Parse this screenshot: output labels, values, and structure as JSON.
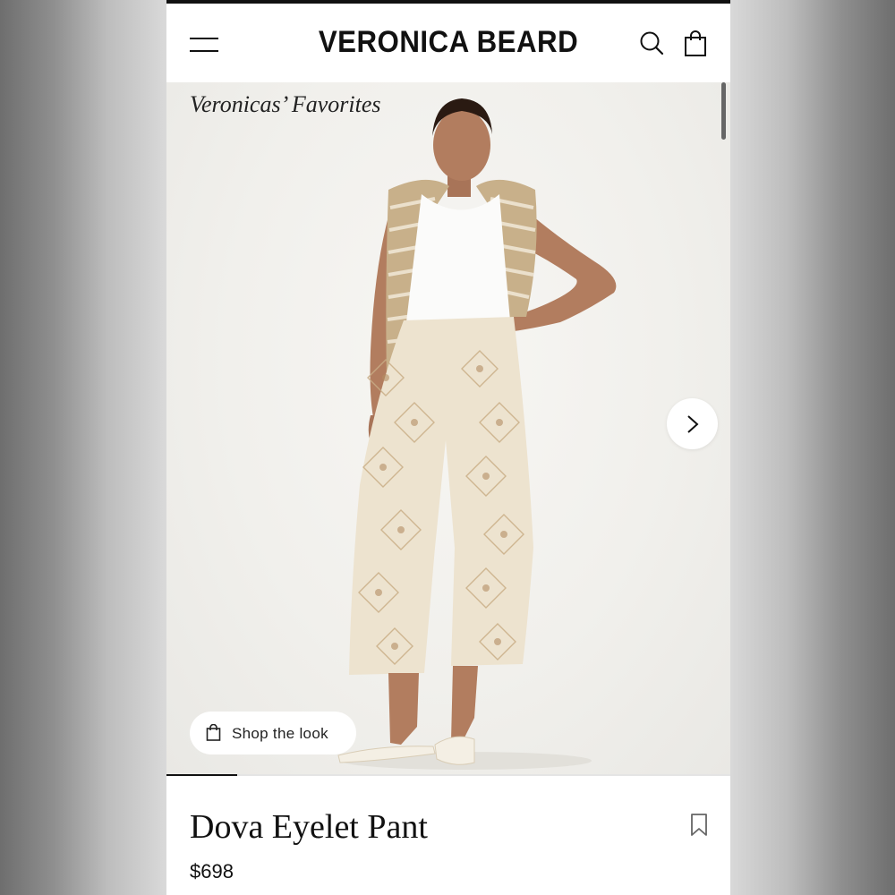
{
  "header": {
    "brand": "VERONICA BEARD",
    "menu_icon": "hamburger-menu-icon",
    "search_icon": "search-icon",
    "bag_icon": "shopping-bag-icon"
  },
  "hero": {
    "collection_title": "Veronicas’ Favorites",
    "next_icon": "chevron-right-icon",
    "shop_the_look": "Shop the look",
    "carousel_progress": 0.125
  },
  "product": {
    "name": "Dova Eyelet Pant",
    "price": "$698",
    "wishlist_icon": "bookmark-icon"
  },
  "colors": {
    "background_left": "#6e6e6e",
    "page_bg": "#ffffff",
    "text": "#111111",
    "hero_bg": "#f1f0ec",
    "pant_color": "#ede3cf",
    "cardigan_color": "#c8b08a"
  }
}
